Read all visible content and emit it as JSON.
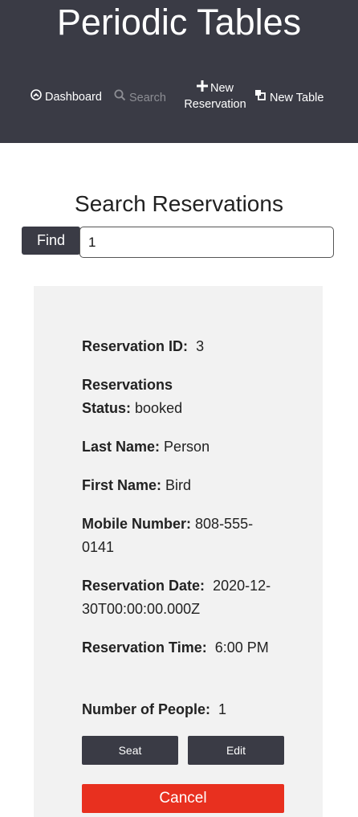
{
  "app": {
    "title": "Periodic Tables"
  },
  "nav": {
    "dashboard": {
      "label": "Dashboard",
      "icon": "dashboard-icon"
    },
    "search": {
      "label": "Search",
      "icon": "search-icon"
    },
    "new_reservation": {
      "label_line1": "New",
      "label_line2": "Reservation",
      "icon": "plus-icon"
    },
    "new_table": {
      "label": "New Table",
      "icon": "layers-icon"
    }
  },
  "search_page": {
    "heading": "Search Reservations",
    "find_label": "Find",
    "input_value": "1"
  },
  "reservation": {
    "id_label": "Reservation ID:",
    "id_value": "3",
    "status_label_line1": "Reservations",
    "status_label_line2": "Status:",
    "status_value": "booked",
    "last_name_label": "Last Name:",
    "last_name_value": "Person",
    "first_name_label": "First Name:",
    "first_name_value": "Bird",
    "mobile_label": "Mobile Number:",
    "mobile_value": "808-555-0141",
    "date_label": "Reservation Date:",
    "date_value": "2020-12-30T00:00:00.000Z",
    "time_label": "Reservation Time:",
    "time_value": "6:00 PM",
    "people_label": "Number of People:",
    "people_value": "1"
  },
  "actions": {
    "seat_label": "Seat",
    "edit_label": "Edit",
    "cancel_label": "Cancel"
  },
  "colors": {
    "header_bg": "#3a3b45",
    "card_bg": "#f2f2f2",
    "cancel_bg": "#e8301f"
  }
}
